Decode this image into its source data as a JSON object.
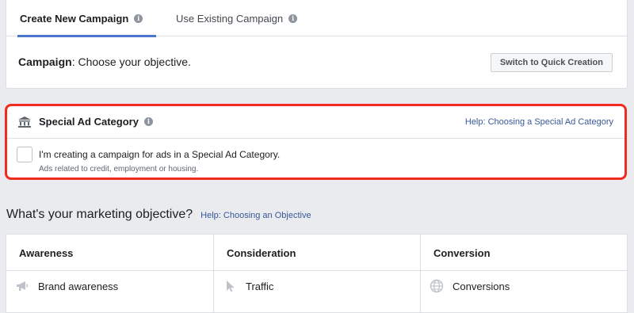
{
  "tabs": {
    "create_label": "Create New Campaign",
    "existing_label": "Use Existing Campaign"
  },
  "campaign": {
    "label": "Campaign",
    "text": ": Choose your objective.",
    "quick_creation_button": "Switch to Quick Creation"
  },
  "special_ad": {
    "title": "Special Ad Category",
    "help_link": "Help: Choosing a Special Ad Category",
    "checkbox_label": "I'm creating a campaign for ads in a Special Ad Category.",
    "checkbox_sublabel": "Ads related to credit, employment or housing.",
    "checked": false,
    "highlight_color": "#f12b1f"
  },
  "objective": {
    "title": "What's your marketing objective?",
    "help_link": "Help: Choosing an Objective",
    "columns": [
      {
        "heading": "Awareness",
        "item": "Brand awareness",
        "icon": "megaphone-icon"
      },
      {
        "heading": "Consideration",
        "item": "Traffic",
        "icon": "cursor-icon"
      },
      {
        "heading": "Conversion",
        "item": "Conversions",
        "icon": "globe-icon"
      }
    ]
  },
  "colors": {
    "accent": "#4a76d1",
    "link": "#385898",
    "background": "#e9ebee"
  }
}
